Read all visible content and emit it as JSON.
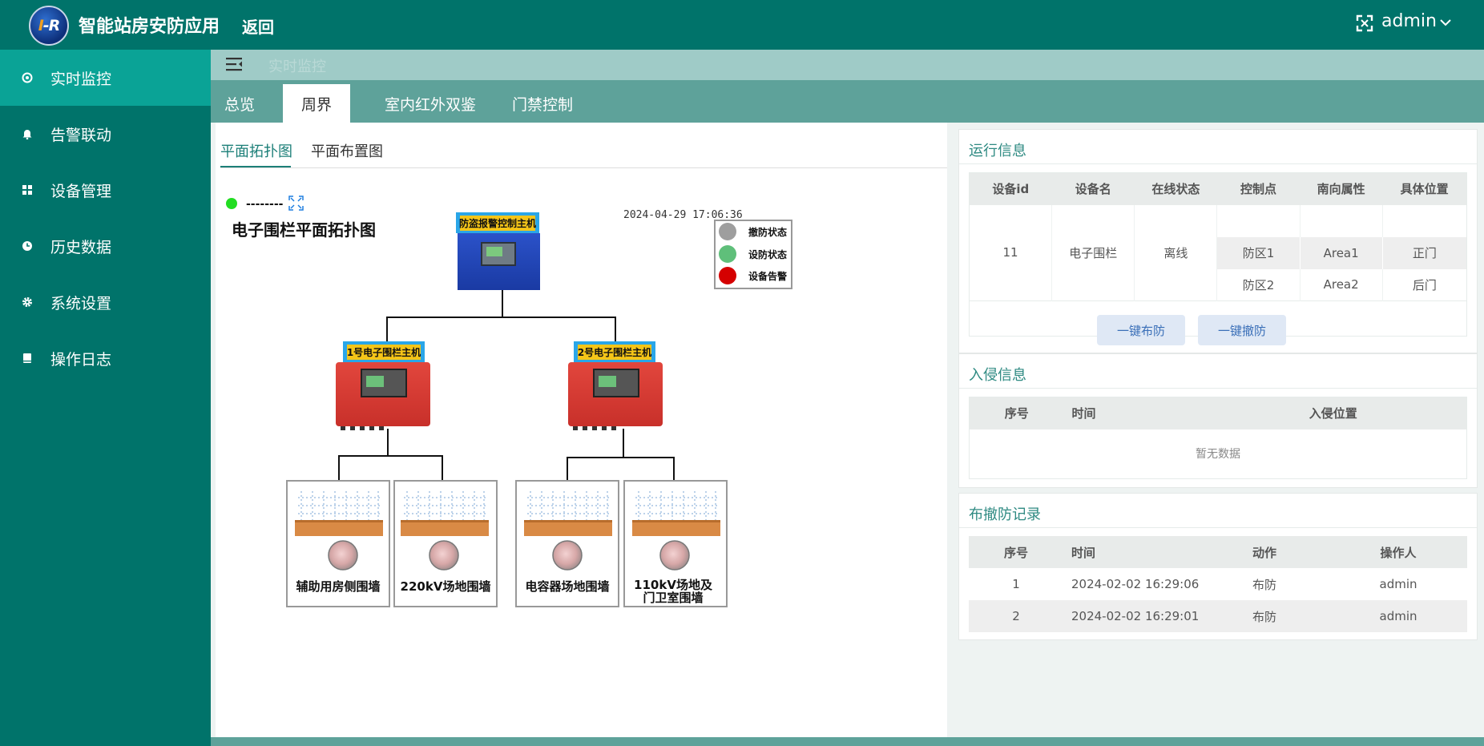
{
  "header": {
    "logo_text_i": "I",
    "logo_text_r": "-R",
    "app_title": "智能站房安防应用",
    "back_label": "返回",
    "user": "admin"
  },
  "sidebar": {
    "items": [
      {
        "label": "实时监控",
        "icon": "monitor-icon"
      },
      {
        "label": "告警联动",
        "icon": "bell-icon"
      },
      {
        "label": "设备管理",
        "icon": "grid-icon"
      },
      {
        "label": "历史数据",
        "icon": "clock-icon"
      },
      {
        "label": "系统设置",
        "icon": "gear-icon"
      },
      {
        "label": "操作日志",
        "icon": "book-icon"
      }
    ]
  },
  "breadcrumb": "实时监控",
  "tabs": [
    "总览",
    "周界",
    "室内红外双鉴",
    "门禁控制"
  ],
  "subtabs": [
    "平面拓扑图",
    "平面布置图"
  ],
  "diagram": {
    "status_text": "--------",
    "title": "电子围栏平面拓扑图",
    "timestamp": "2024-04-29 17:06:36",
    "controller_label": "防盗报警控制主机",
    "host1_label": "1号电子围栏主机",
    "host2_label": "2号电子围栏主机",
    "legend": [
      "撤防状态",
      "设防状态",
      "设备告警"
    ],
    "zones": [
      "辅助用房侧围墙",
      "220kV场地围墙",
      "电容器场地围墙",
      "110kV场地及",
      "门卫室围墙"
    ]
  },
  "run_info": {
    "title": "运行信息",
    "headers": [
      "设备id",
      "设备名",
      "在线状态",
      "控制点",
      "南向属性",
      "具体位置"
    ],
    "device_id": "11",
    "device_name": "电子围栏",
    "online_status": "离线",
    "points": [
      {
        "control": "防区1",
        "attr": "Area1",
        "location": "正门"
      },
      {
        "control": "防区2",
        "attr": "Area2",
        "location": "后门"
      }
    ],
    "arm_btn": "一键布防",
    "disarm_btn": "一键撤防"
  },
  "intrusion": {
    "title": "入侵信息",
    "headers": [
      "序号",
      "时间",
      "入侵位置"
    ],
    "empty": "暂无数据"
  },
  "arm_records": {
    "title": "布撤防记录",
    "headers": [
      "序号",
      "时间",
      "动作",
      "操作人"
    ],
    "rows": [
      {
        "no": "1",
        "time": "2024-02-02 16:29:06",
        "action": "布防",
        "user": "admin"
      },
      {
        "no": "2",
        "time": "2024-02-02 16:29:01",
        "action": "布防",
        "user": "admin"
      }
    ]
  },
  "colors": {
    "header": "#00736a",
    "sidebar_active": "#0aa396",
    "accent": "#1c7f78",
    "alarm_red": "#d9302b",
    "armed_green": "#5fbf7a",
    "disarmed_gray": "#9e9e9e",
    "status_green": "#22dd22"
  }
}
